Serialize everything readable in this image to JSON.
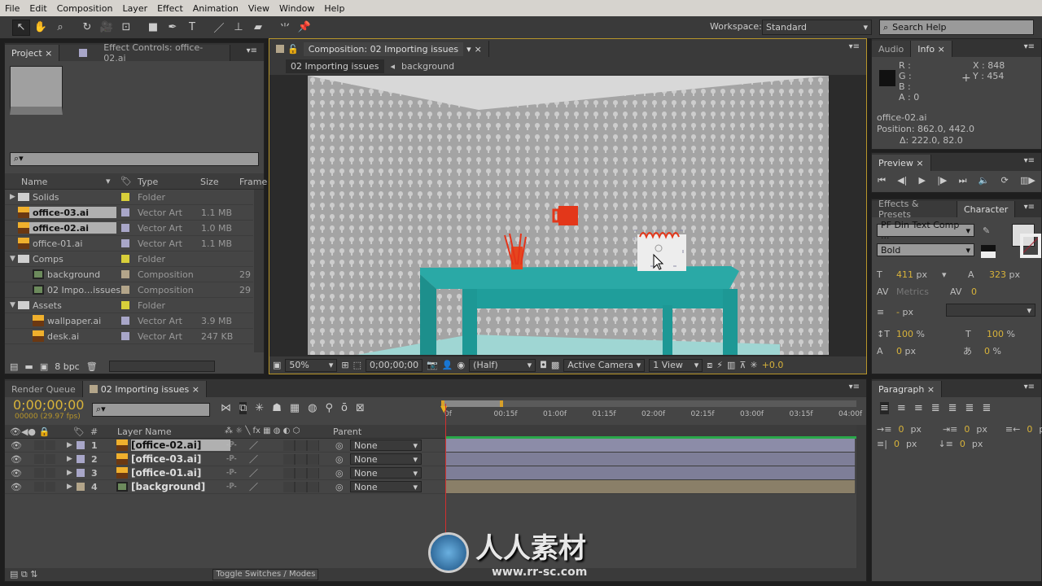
{
  "menu": [
    "File",
    "Edit",
    "Composition",
    "Layer",
    "Effect",
    "Animation",
    "View",
    "Window",
    "Help"
  ],
  "toolbar": {
    "tools": [
      "selection-icon",
      "hand-icon",
      "zoom-icon",
      "rotate-icon",
      "camera-icon",
      "pan-behind-icon",
      "rectangle-icon",
      "pen-icon",
      "text-icon",
      "brush-icon",
      "clone-stamp-icon",
      "eraser-icon",
      "roto-brush-icon",
      "puppet-pin-icon"
    ],
    "workspace_label": "Workspace:",
    "workspace_value": "Standard",
    "search_placeholder": "Search Help"
  },
  "project": {
    "tabs": [
      "Project",
      "Effect Controls: office-02.ai"
    ],
    "search_placeholder": "⌕▾",
    "columns": [
      "Name",
      "Type",
      "Size",
      "Frame"
    ],
    "items": [
      {
        "name": "Solids",
        "type": "Folder",
        "size": "",
        "frame": "",
        "kind": "folder",
        "label": "#d8cf3a",
        "indent": 0,
        "twirl": "▶",
        "selected": false
      },
      {
        "name": "office-03.ai",
        "type": "Vector Art",
        "size": "1.1 MB",
        "frame": "",
        "kind": "ai",
        "label": "#a8a6c8",
        "indent": 0,
        "twirl": "",
        "selected": true
      },
      {
        "name": "office-02.ai",
        "type": "Vector Art",
        "size": "1.0 MB",
        "frame": "",
        "kind": "ai",
        "label": "#a8a6c8",
        "indent": 0,
        "twirl": "",
        "selected": true
      },
      {
        "name": "office-01.ai",
        "type": "Vector Art",
        "size": "1.1 MB",
        "frame": "",
        "kind": "ai",
        "label": "#a8a6c8",
        "indent": 0,
        "twirl": "",
        "selected": false
      },
      {
        "name": "Comps",
        "type": "Folder",
        "size": "",
        "frame": "",
        "kind": "folder",
        "label": "#d8cf3a",
        "indent": 0,
        "twirl": "▼",
        "selected": false
      },
      {
        "name": "background",
        "type": "Composition",
        "size": "",
        "frame": "29",
        "kind": "comp",
        "label": "#b3a58a",
        "indent": 1,
        "twirl": "",
        "selected": false
      },
      {
        "name": "02 Impo…issues",
        "type": "Composition",
        "size": "",
        "frame": "29",
        "kind": "comp",
        "label": "#b3a58a",
        "indent": 1,
        "twirl": "",
        "selected": false
      },
      {
        "name": "Assets",
        "type": "Folder",
        "size": "",
        "frame": "",
        "kind": "folder",
        "label": "#d8cf3a",
        "indent": 0,
        "twirl": "▼",
        "selected": false
      },
      {
        "name": "wallpaper.ai",
        "type": "Vector Art",
        "size": "3.9 MB",
        "frame": "",
        "kind": "ai",
        "label": "#a8a6c8",
        "indent": 1,
        "twirl": "",
        "selected": false
      },
      {
        "name": "desk.ai",
        "type": "Vector Art",
        "size": "247 KB",
        "frame": "",
        "kind": "ai",
        "label": "#a8a6c8",
        "indent": 1,
        "twirl": "",
        "selected": false
      }
    ],
    "bpc": "8 bpc"
  },
  "composition": {
    "tab": "Composition: 02 Importing issues",
    "breadcrumbs": [
      "02 Importing issues",
      "background"
    ],
    "zoom": "50%",
    "timecode": "0;00;00;00",
    "resolution": "(Half)",
    "camera": "Active Camera",
    "views": "1 View",
    "exposure": "+0.0"
  },
  "info": {
    "tabs": [
      "Audio",
      "Info"
    ],
    "r": "R :",
    "g": "G :",
    "b": "B :",
    "a": "A : 0",
    "x": "X : 848",
    "y": "Y : 454",
    "layer": "office-02.ai",
    "position": "Position: 862.0, 442.0",
    "delta": "Δ: 222.0, 82.0"
  },
  "preview": {
    "tab": "Preview",
    "controls": [
      "first-frame-icon",
      "prev-frame-icon",
      "play-icon",
      "next-frame-icon",
      "last-frame-icon",
      "audio-icon",
      "loop-icon",
      "ram-preview-icon"
    ]
  },
  "character": {
    "tabs": [
      "Effects & Presets",
      "Character"
    ],
    "font": "PF Din Text Comp ...",
    "style": "Bold",
    "size": "411",
    "size_unit": "px",
    "leading": "323",
    "leading_unit": "px",
    "kerning": "Metrics",
    "tracking": "0",
    "stroke": "-",
    "stroke_unit": "px",
    "vscale": "100",
    "hscale": "100",
    "baseline": "0",
    "baseline_unit": "px",
    "tsume": "0",
    "pct": "%"
  },
  "paragraph": {
    "tab": "Paragraph",
    "indent_left": "0",
    "indent_first": "0",
    "indent_right": "0",
    "space_before": "0",
    "space_after": "0",
    "unit": "px"
  },
  "timeline": {
    "tabs": [
      "Render Queue",
      "02 Importing issues"
    ],
    "timecode": "0;00;00;00",
    "frame_info": "00000 (29.97 fps)",
    "search_placeholder": "⌕▾",
    "columns": {
      "name": "Layer Name",
      "num": "#",
      "parent": "Parent"
    },
    "ruler": [
      "0f",
      "00:15f",
      "01:00f",
      "01:15f",
      "02:00f",
      "02:15f",
      "03:00f",
      "03:15f",
      "04:00f"
    ],
    "layers": [
      {
        "num": "1",
        "name": "[office-02.ai]",
        "kind": "ai",
        "label": "#a8a6c8",
        "parent": "None",
        "bar": "#8c8ca8",
        "selected": true
      },
      {
        "num": "2",
        "name": "[office-03.ai]",
        "kind": "ai",
        "label": "#a8a6c8",
        "parent": "None",
        "bar": "#7e7e98",
        "selected": false
      },
      {
        "num": "3",
        "name": "[office-01.ai]",
        "kind": "ai",
        "label": "#a8a6c8",
        "parent": "None",
        "bar": "#7e7e98",
        "selected": false
      },
      {
        "num": "4",
        "name": "[background]",
        "kind": "comp",
        "label": "#b3a58a",
        "parent": "None",
        "bar": "#8a7f68",
        "selected": false
      }
    ],
    "toggle": "Toggle Switches / Modes"
  },
  "watermark": {
    "text": "人人素材",
    "url": "www.rr-sc.com"
  }
}
